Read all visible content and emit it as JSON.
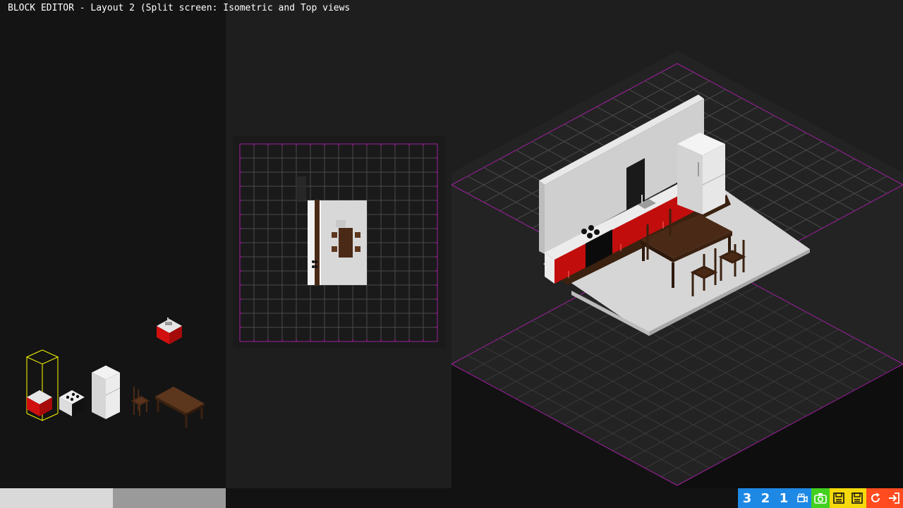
{
  "app": {
    "title": "BLOCK EDITOR - Layout 2 (Split screen: Isometric and Top views"
  },
  "palette": {
    "items": [
      {
        "name": "sink-cabinet"
      },
      {
        "name": "base-cabinet",
        "selected": true
      },
      {
        "name": "stove"
      },
      {
        "name": "refrigerator"
      },
      {
        "name": "chair"
      },
      {
        "name": "table"
      }
    ]
  },
  "toolbar": {
    "buttons": [
      {
        "label": "3",
        "color": "#1e88e5"
      },
      {
        "label": "2",
        "color": "#1e88e5"
      },
      {
        "label": "1",
        "color": "#1e88e5"
      },
      {
        "icon": "camera-video-icon",
        "color": "#1e88e5"
      },
      {
        "icon": "camera-icon",
        "color": "#43d11f"
      },
      {
        "icon": "save-icon",
        "color": "#f5d90a"
      },
      {
        "icon": "save-as-icon",
        "color": "#f5d90a"
      },
      {
        "icon": "refresh-icon",
        "color": "#ff4b1f"
      },
      {
        "icon": "exit-icon",
        "color": "#ff4b1f"
      }
    ]
  },
  "colors": {
    "cabinet_red": "#d10f0f",
    "floor": "#d8d8d8",
    "wall": "#c8c8c8",
    "wood": "#4a2a16",
    "grid_border": "#a020a0",
    "selection": "#ffff00"
  }
}
